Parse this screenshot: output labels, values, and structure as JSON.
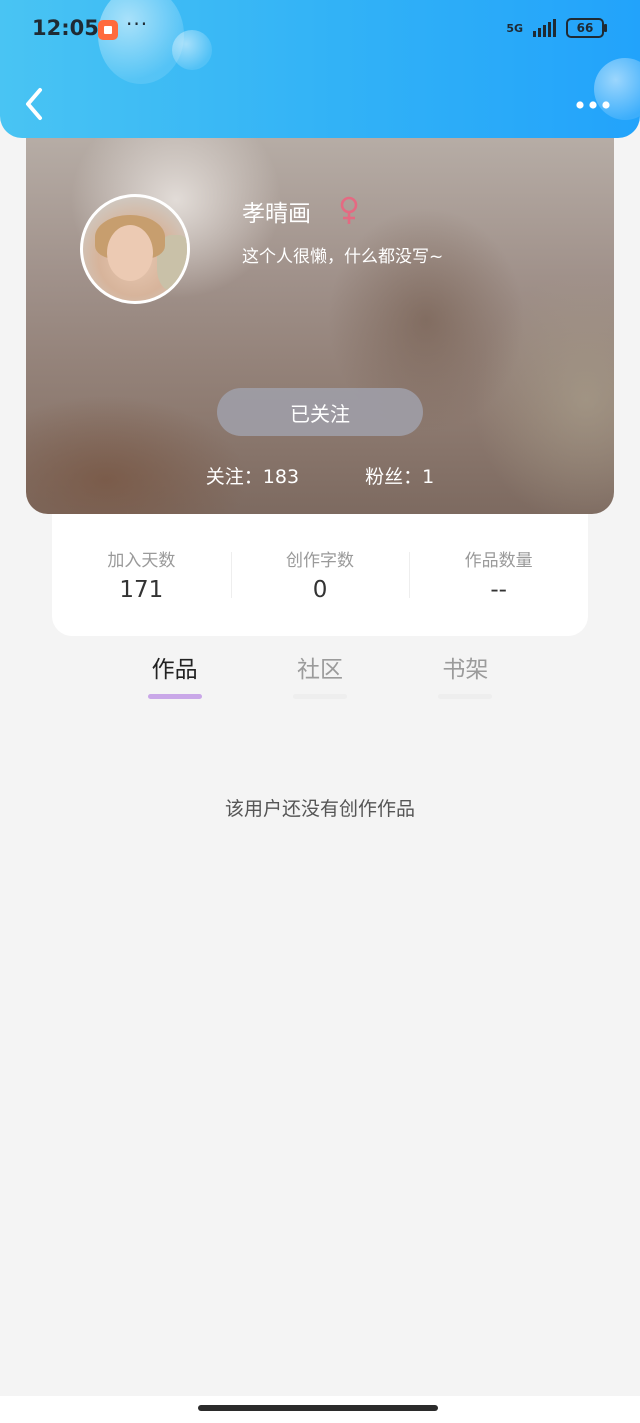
{
  "status_bar": {
    "time": "12:05",
    "more": "···",
    "network": "5G",
    "battery": "66"
  },
  "header": {
    "back_icon": "chevron-left-icon",
    "more_icon": "more-horizontal-icon"
  },
  "profile": {
    "name": "孝晴画",
    "gender_icon": "female-icon",
    "gender_color": "#e46a82",
    "bio": "这个人很懒，什么都没写~",
    "follow_button": "已关注",
    "following_label": "关注：",
    "following_count": "183",
    "followers_label": "粉丝：",
    "followers_count": "1"
  },
  "stats": [
    {
      "label": "加入天数",
      "value": "171"
    },
    {
      "label": "创作字数",
      "value": "0"
    },
    {
      "label": "作品数量",
      "value": "--"
    }
  ],
  "tabs": [
    {
      "label": "作品",
      "active": true
    },
    {
      "label": "社区",
      "active": false
    },
    {
      "label": "书架",
      "active": false
    }
  ],
  "empty_message": "该用户还没有创作作品",
  "colors": {
    "header_gradient_start": "#49c4f3",
    "header_gradient_end": "#22a3fb",
    "tab_indicator_active": "#c9a7e8"
  }
}
